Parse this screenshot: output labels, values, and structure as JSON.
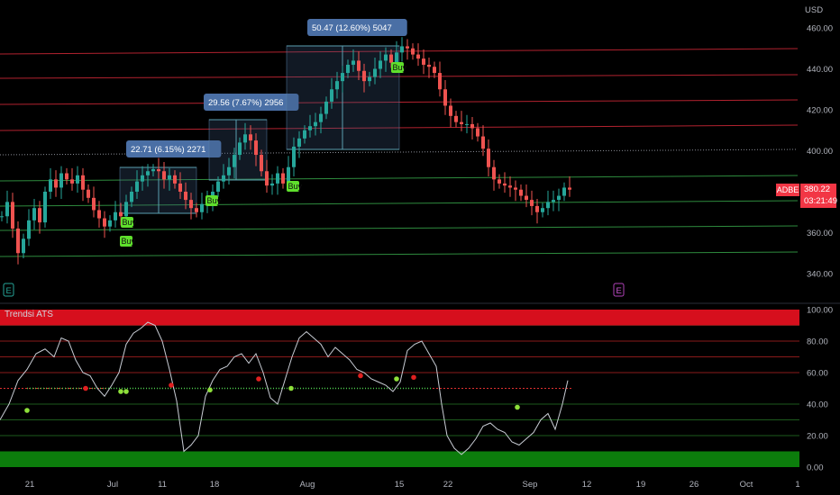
{
  "chart_data": {
    "type": "candlestick",
    "currency": "USD",
    "symbol": "ADBE",
    "last_price": "380.22",
    "countdown": "03:21:49",
    "price_axis": {
      "ticks": [
        "460.00",
        "440.00",
        "420.00",
        "400.00",
        "380.00",
        "360.00",
        "340.00"
      ]
    },
    "indicator": {
      "title": "Trendsi ATS",
      "ticks": [
        "100.00",
        "80.00",
        "60.00",
        "40.00",
        "20.00",
        "0.00"
      ],
      "upper_band": [
        90,
        100
      ],
      "lower_band": [
        0,
        10
      ],
      "mid_level": 50
    },
    "time_axis": [
      "21",
      "Jul",
      "11",
      "18",
      "Aug",
      "15",
      "22",
      "Sep",
      "12",
      "19",
      "26",
      "Oct",
      "1"
    ],
    "measurements": [
      "22.71 (6.15%) 2271",
      "29.56 (7.67%) 2956",
      "50.47 (12.60%) 5047"
    ],
    "signals": [
      "Buy",
      "Buy",
      "Buy",
      "Buy",
      "Buy"
    ],
    "event_markers": [
      "E",
      "E"
    ],
    "colors": {
      "up": "#26a69a",
      "down": "#ef5350",
      "resistance": "#b2222f",
      "support": "#2e8b3e",
      "buy_badge": "#5fe02c",
      "measure_box": "#4a6fa5",
      "band_red": "#d60f1d",
      "band_green": "#0c7d0c"
    }
  }
}
